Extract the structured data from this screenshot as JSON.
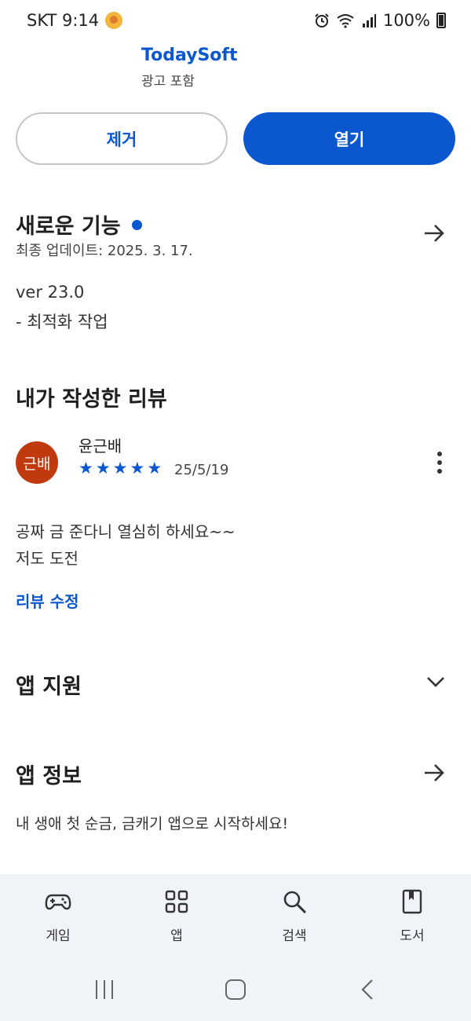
{
  "status_bar": {
    "carrier_time": "SKT 9:14",
    "battery": "100%"
  },
  "app": {
    "developer": "TodaySoft",
    "ads_note": "광고 포함"
  },
  "actions": {
    "remove_label": "제거",
    "open_label": "열기"
  },
  "whats_new": {
    "title": "새로운 기능",
    "updated": "최종 업데이트: 2025. 3. 17.",
    "version": "ver 23.0",
    "changes": "- 최적화 작업"
  },
  "my_review": {
    "title": "내가 작성한 리뷰",
    "avatar_text": "근배",
    "reviewer": "윤근배",
    "rating": 5,
    "date": "25/5/19",
    "text_line1": "공짜 금 준다니 열심히 하세요~~",
    "text_line2": "저도 도전",
    "edit_label": "리뷰 수정"
  },
  "app_support": {
    "title": "앱 지원"
  },
  "about": {
    "title": "앱 정보",
    "description": "내 생애 첫 순금, 금캐기 앱으로 시작하세요!"
  },
  "bottom_nav": {
    "items": [
      {
        "label": "게임",
        "icon": "gamepad-icon"
      },
      {
        "label": "앱",
        "icon": "apps-grid-icon"
      },
      {
        "label": "검색",
        "icon": "search-icon"
      },
      {
        "label": "도서",
        "icon": "book-icon"
      }
    ]
  },
  "colors": {
    "accent": "#0b57d0",
    "avatar": "#c1390f",
    "nav_bg": "#f0f4f9"
  }
}
